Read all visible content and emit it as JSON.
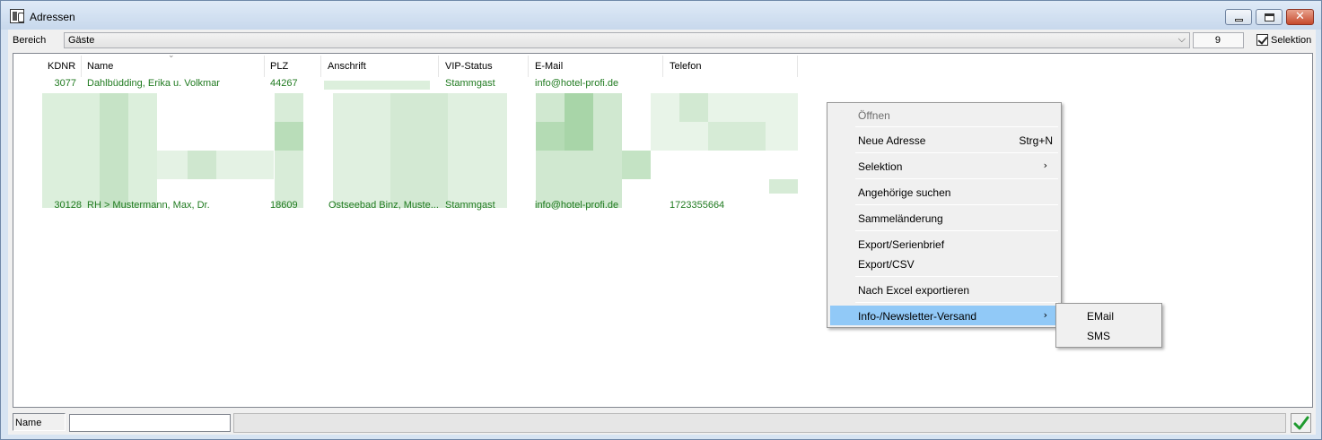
{
  "window": {
    "title": "Adressen"
  },
  "toolbar": {
    "bereich_label": "Bereich",
    "bereich_value": "Gäste",
    "count": "9",
    "selektion_label": "Selektion",
    "selektion_checked": true
  },
  "table": {
    "columns": [
      "KDNR",
      "Name",
      "PLZ",
      "Anschrift",
      "VIP-Status",
      "E-Mail",
      "Telefon"
    ],
    "rows": [
      {
        "kdnr": "3077",
        "name": "Dahlbüdding, Erika u. Volkmar",
        "plz": "44267",
        "anschrift": "",
        "vip": "Stammgast",
        "email": "info@hotel-profi.de",
        "telefon": ""
      },
      {
        "kdnr": "30128",
        "name": "RH >  Mustermann, Max, Dr.",
        "plz": "18609",
        "anschrift": "Ostseebad Binz, Muste...",
        "vip": "Stammgast",
        "email": "info@hotel-profi.de",
        "telefon": "1723355664"
      }
    ]
  },
  "context_menu": {
    "items": [
      {
        "label": "Öffnen",
        "shortcut": "",
        "disabled": true
      },
      {
        "label": "Neue Adresse",
        "shortcut": "Strg+N"
      },
      {
        "label": "Selektion",
        "submenu_arrow": "›"
      },
      {
        "label": "Angehörige suchen"
      },
      {
        "label": "Sammeländerung"
      },
      {
        "label": "Export/Serienbrief"
      },
      {
        "label": "Export/CSV"
      },
      {
        "label": "Nach Excel exportieren"
      },
      {
        "label": "Info-/Newsletter-Versand",
        "submenu_arrow": "›",
        "highlighted": true
      }
    ]
  },
  "submenu": {
    "items": [
      {
        "label": "EMail"
      },
      {
        "label": "SMS"
      }
    ]
  },
  "bottom": {
    "name_label": "Name",
    "name_value": ""
  },
  "colors": {
    "row_text": "#1f7a1f",
    "highlight": "#91c9f7",
    "title_bar": "#c7d8ec"
  }
}
